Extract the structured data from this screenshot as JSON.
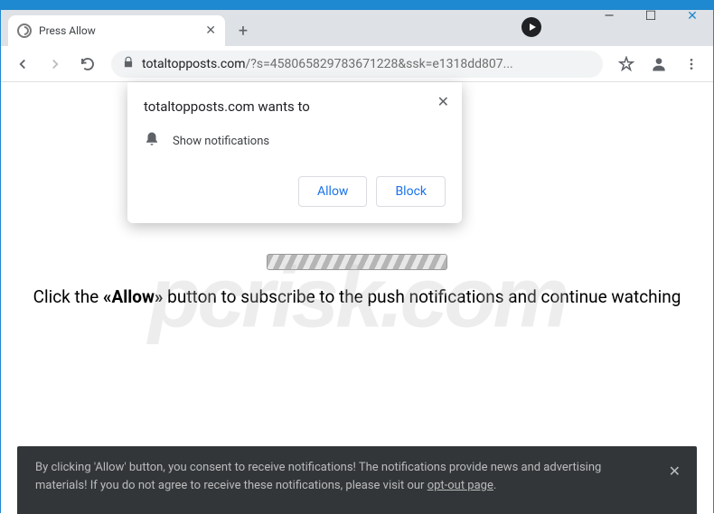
{
  "window": {
    "minimize": "—",
    "maximize": "☐",
    "close": "✕"
  },
  "tab": {
    "title": "Press Allow",
    "close": "✕",
    "new": "+"
  },
  "address": {
    "domain": "totaltopposts.com",
    "path": "/?s=458065829783671228&ssk=e1318dd807..."
  },
  "permission": {
    "title": "totaltopposts.com wants to",
    "item": "Show notifications",
    "allow": "Allow",
    "block": "Block",
    "close": "✕"
  },
  "page": {
    "text_before": "Click the ",
    "text_bold": "«Allow»",
    "text_after": " button to subscribe to the push notifications and continue watching"
  },
  "consent": {
    "text_before": "By clicking 'Allow' button, you consent to receive notifications! The notifications provide news and advertising materials! If you do not agree to receive these notifications, please visit our ",
    "link": "opt-out page",
    "text_after": ".",
    "close": "✕"
  },
  "watermark": "pcrisk.com"
}
